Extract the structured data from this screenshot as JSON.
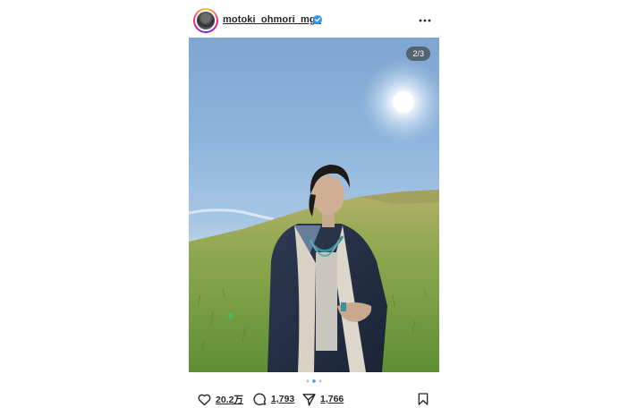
{
  "post": {
    "username": "motoki_ohmori_mga",
    "image_counter": "2/3",
    "carousel": {
      "total": 3,
      "current": 2
    },
    "likes": "20.2万",
    "comments": "1,793",
    "shares": "1,766",
    "icons": {
      "verified": "verified-badge-icon",
      "more": "more-options-icon",
      "like": "heart-icon",
      "comment": "comment-bubble-icon",
      "share": "send-icon",
      "save": "bookmark-icon"
    },
    "colors": {
      "verified": "#3897f0",
      "dot_active": "#3897f0",
      "dot_inactive": "#c7c7c7"
    }
  }
}
